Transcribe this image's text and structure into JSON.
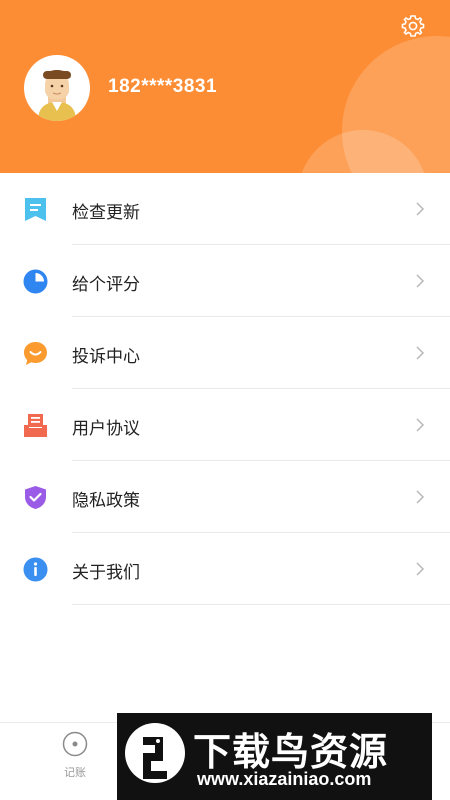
{
  "header": {
    "phone": "182****3831",
    "background_color": "#fd8d35",
    "settings_icon": "gear-icon",
    "avatar_icon": "user-avatar"
  },
  "menu": {
    "items": [
      {
        "label": "检查更新",
        "icon": "bookmark-doc-icon",
        "icon_color": "#4cc1ee"
      },
      {
        "label": "给个评分",
        "icon": "pie-chart-icon",
        "icon_color": "#2f86f0"
      },
      {
        "label": "投诉中心",
        "icon": "smile-chat-icon",
        "icon_color": "#fb9a2e"
      },
      {
        "label": "用户协议",
        "icon": "document-tray-icon",
        "icon_color": "#f16a4f"
      },
      {
        "label": "隐私政策",
        "icon": "shield-check-icon",
        "icon_color": "#9a5ce6"
      },
      {
        "label": "关于我们",
        "icon": "info-icon",
        "icon_color": "#3a8ff1"
      }
    ],
    "chevron_icon": "chevron-right-icon"
  },
  "tabbar": {
    "tabs": [
      {
        "label": "记账",
        "icon": "clock-circle-icon"
      }
    ]
  },
  "watermark": {
    "title": "下载鸟资源",
    "url": "www.xiazainiao.com"
  }
}
